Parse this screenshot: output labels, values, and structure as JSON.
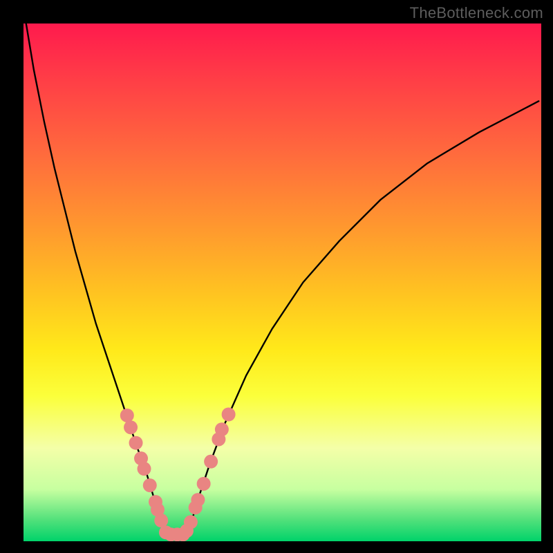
{
  "watermark": "TheBottleneck.com",
  "chart_data": {
    "type": "line",
    "title": "",
    "xlabel": "",
    "ylabel": "",
    "xlim": [
      0,
      100
    ],
    "ylim": [
      0,
      100
    ],
    "series": [
      {
        "name": "left-curve",
        "x": [
          0.5,
          2,
          4,
          6,
          8,
          10,
          12,
          14,
          16,
          18,
          20,
          22,
          23.5,
          25,
          26.2,
          27.2,
          28
        ],
        "y": [
          100,
          91,
          81,
          72,
          64,
          56,
          49,
          42,
          36,
          30,
          24,
          18,
          14,
          9,
          5,
          2,
          0.5
        ]
      },
      {
        "name": "right-curve",
        "x": [
          31,
          32.5,
          34,
          36,
          39,
          43,
          48,
          54,
          61,
          69,
          78,
          88,
          99.5
        ],
        "y": [
          0.5,
          4,
          9,
          15,
          23,
          32,
          41,
          50,
          58,
          66,
          73,
          79,
          85
        ]
      }
    ],
    "dots": {
      "name": "data-points",
      "color": "#e98582",
      "radius_px": 10,
      "points": [
        {
          "x": 20.0,
          "y": 24.3
        },
        {
          "x": 20.7,
          "y": 22.0
        },
        {
          "x": 21.7,
          "y": 19.0
        },
        {
          "x": 22.7,
          "y": 16.0
        },
        {
          "x": 23.3,
          "y": 14.0
        },
        {
          "x": 24.4,
          "y": 10.8
        },
        {
          "x": 25.5,
          "y": 7.6
        },
        {
          "x": 25.9,
          "y": 6.1
        },
        {
          "x": 26.6,
          "y": 4.0
        },
        {
          "x": 27.5,
          "y": 1.7
        },
        {
          "x": 28.5,
          "y": 1.3
        },
        {
          "x": 29.7,
          "y": 1.3
        },
        {
          "x": 30.8,
          "y": 1.3
        },
        {
          "x": 31.5,
          "y": 2.0
        },
        {
          "x": 32.3,
          "y": 3.7
        },
        {
          "x": 33.2,
          "y": 6.5
        },
        {
          "x": 33.7,
          "y": 8.0
        },
        {
          "x": 34.8,
          "y": 11.1
        },
        {
          "x": 36.2,
          "y": 15.4
        },
        {
          "x": 37.7,
          "y": 19.7
        },
        {
          "x": 38.3,
          "y": 21.6
        },
        {
          "x": 39.6,
          "y": 24.5
        }
      ]
    }
  }
}
